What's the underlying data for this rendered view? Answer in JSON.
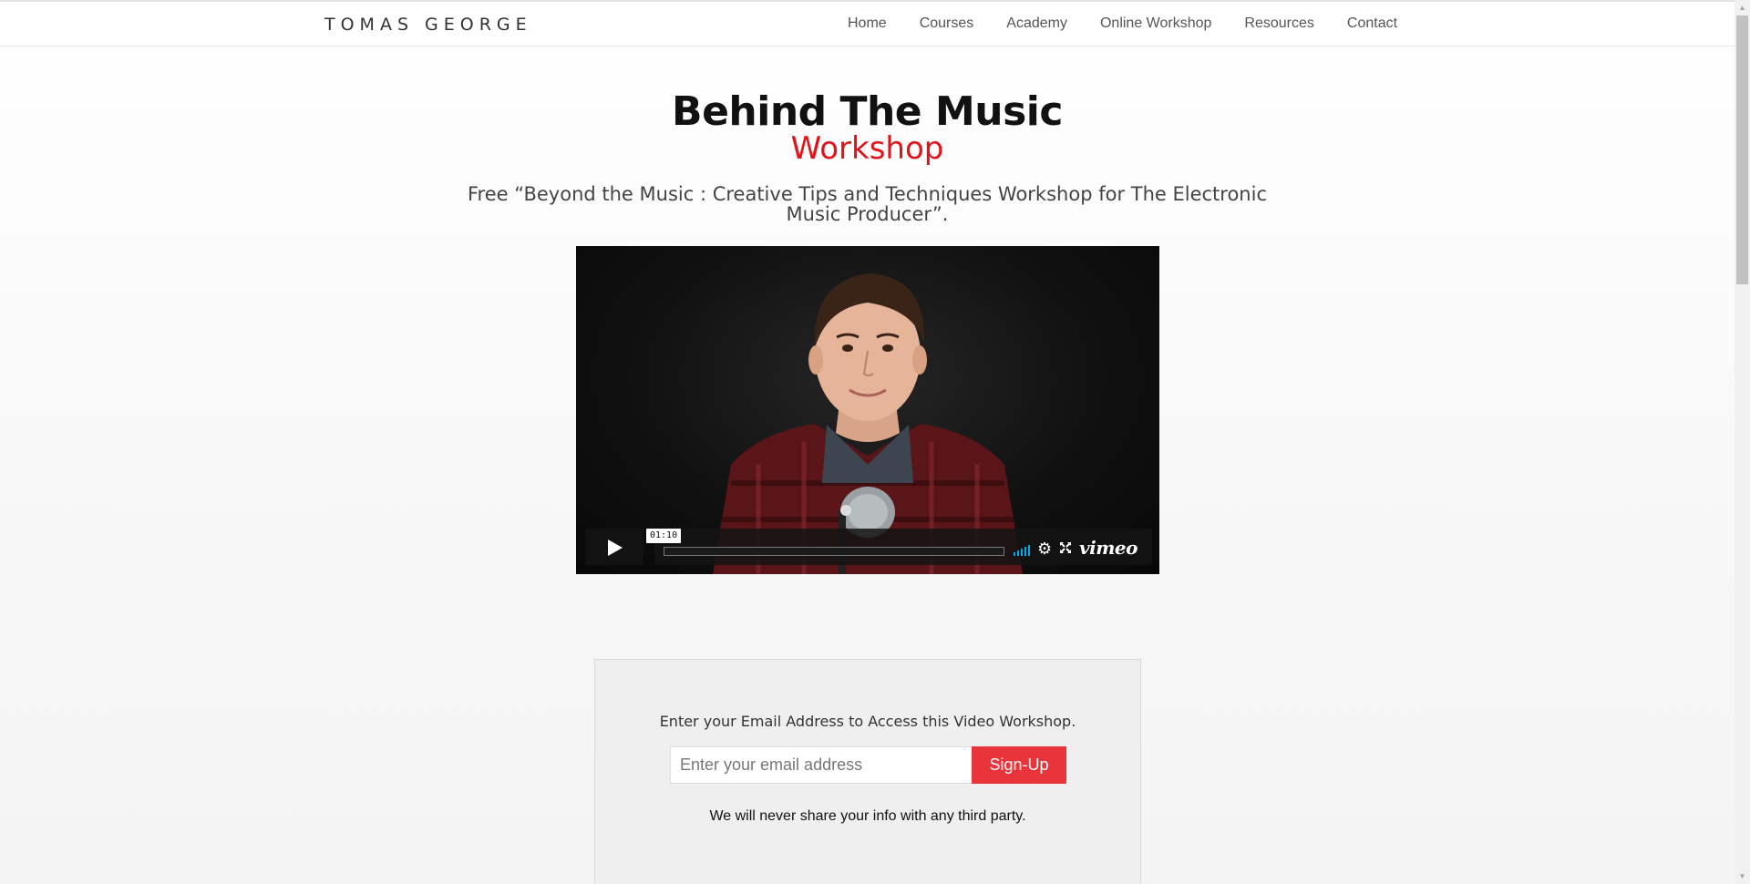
{
  "header": {
    "brand": "TOMAS GEORGE",
    "nav": [
      {
        "label": "Home"
      },
      {
        "label": "Courses"
      },
      {
        "label": "Academy"
      },
      {
        "label": "Online Workshop"
      },
      {
        "label": "Resources"
      },
      {
        "label": "Contact"
      }
    ]
  },
  "hero": {
    "title": "Behind The Music",
    "subtitle": "Workshop",
    "subtitle_color": "#e0151b",
    "lead": "Free “Beyond the Music : Creative Tips and Techniques Workshop for The Electronic Music Producer”."
  },
  "video": {
    "timestamp": "01:10",
    "progress": 0,
    "player_brand": "vimeo",
    "icons": [
      "play-icon",
      "volume-icon",
      "settings-gear-icon",
      "fullscreen-icon"
    ],
    "volume_accent": "#00adef"
  },
  "signup": {
    "prompt": "Enter your Email Address to Access this Video Workshop.",
    "email_placeholder": "Enter your email address",
    "email_value": "",
    "button_label": "Sign-Up",
    "button_color": "#e8343a",
    "note": "We will never share your info with any third party."
  }
}
